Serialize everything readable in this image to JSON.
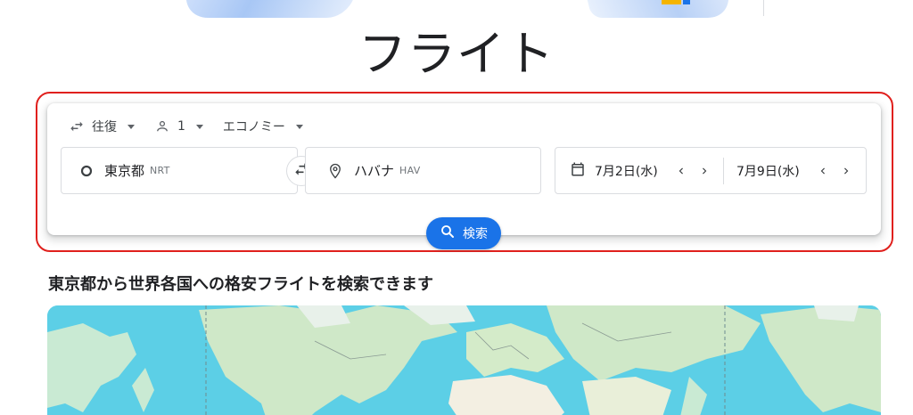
{
  "page": {
    "title": "フライト",
    "section_heading": "東京都から世界各国への格安フライトを検索できます"
  },
  "search_options": {
    "trip_type": "往復",
    "passengers": "1",
    "cabin_class": "エコノミー"
  },
  "origin": {
    "city": "東京都",
    "code": "NRT"
  },
  "destination": {
    "city": "ハバナ",
    "code": "HAV"
  },
  "dates": {
    "depart": "7月2日(水)",
    "return": "7月9日(水)"
  },
  "search_button": {
    "label": "検索"
  },
  "colors": {
    "accent": "#1a73e8",
    "highlight_border": "#e0201d",
    "ocean": "#5ccfe6",
    "land": "#c9ead3"
  },
  "icons": {
    "trip_type": "swap-horiz-icon",
    "passengers": "person-outline-icon",
    "origin": "circle-outline-icon",
    "destination": "location-pin-icon",
    "swap": "swap-arrows-icon",
    "calendar": "calendar-icon",
    "search": "search-icon"
  }
}
